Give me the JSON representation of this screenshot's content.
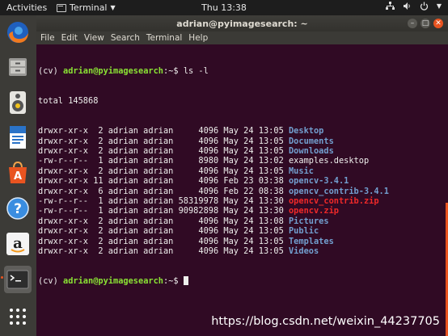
{
  "topbar": {
    "activities": "Activities",
    "app_name": "Terminal",
    "clock": "Thu 13:38"
  },
  "dock": {
    "items": [
      {
        "name": "Firefox"
      },
      {
        "name": "Files"
      },
      {
        "name": "Rhythmbox"
      },
      {
        "name": "LibreOffice Writer"
      },
      {
        "name": "Ubuntu Software"
      },
      {
        "name": "Help"
      },
      {
        "name": "Amazon"
      },
      {
        "name": "Terminal"
      },
      {
        "name": "Show Applications"
      }
    ]
  },
  "window": {
    "title": "adrian@pyimagesearch: ~",
    "menu": [
      "File",
      "Edit",
      "View",
      "Search",
      "Terminal",
      "Help"
    ]
  },
  "terminal": {
    "prompt_env": "(cv) ",
    "prompt_user_host": "adrian@pyimagesearch",
    "prompt_path": ":~$ ",
    "command": "ls -l",
    "total": "total 145868",
    "rows": [
      {
        "meta": "drwxr-xr-x  2 adrian adrian     4096 May 24 13:05 ",
        "name": "Desktop",
        "kind": "dir"
      },
      {
        "meta": "drwxr-xr-x  2 adrian adrian     4096 May 24 13:05 ",
        "name": "Documents",
        "kind": "dir"
      },
      {
        "meta": "drwxr-xr-x  2 adrian adrian     4096 May 24 13:05 ",
        "name": "Downloads",
        "kind": "dir"
      },
      {
        "meta": "-rw-r--r--  1 adrian adrian     8980 May 24 13:02 ",
        "name": "examples.desktop",
        "kind": "file"
      },
      {
        "meta": "drwxr-xr-x  2 adrian adrian     4096 May 24 13:05 ",
        "name": "Music",
        "kind": "dir"
      },
      {
        "meta": "drwxr-xr-x 11 adrian adrian     4096 Feb 23 03:38 ",
        "name": "opencv-3.4.1",
        "kind": "dir"
      },
      {
        "meta": "drwxr-xr-x  6 adrian adrian     4096 Feb 22 08:38 ",
        "name": "opencv_contrib-3.4.1",
        "kind": "dir"
      },
      {
        "meta": "-rw-r--r--  1 adrian adrian 58319978 May 24 13:30 ",
        "name": "opencv_contrib.zip",
        "kind": "archive"
      },
      {
        "meta": "-rw-r--r--  1 adrian adrian 90982898 May 24 13:30 ",
        "name": "opencv.zip",
        "kind": "archive"
      },
      {
        "meta": "drwxr-xr-x  2 adrian adrian     4096 May 24 13:08 ",
        "name": "Pictures",
        "kind": "dir"
      },
      {
        "meta": "drwxr-xr-x  2 adrian adrian     4096 May 24 13:05 ",
        "name": "Public",
        "kind": "dir"
      },
      {
        "meta": "drwxr-xr-x  2 adrian adrian     4096 May 24 13:05 ",
        "name": "Templates",
        "kind": "dir"
      },
      {
        "meta": "drwxr-xr-x  2 adrian adrian     4096 May 24 13:05 ",
        "name": "Videos",
        "kind": "dir"
      }
    ]
  },
  "watermark": "https://blog.csdn.net/weixin_44237705"
}
